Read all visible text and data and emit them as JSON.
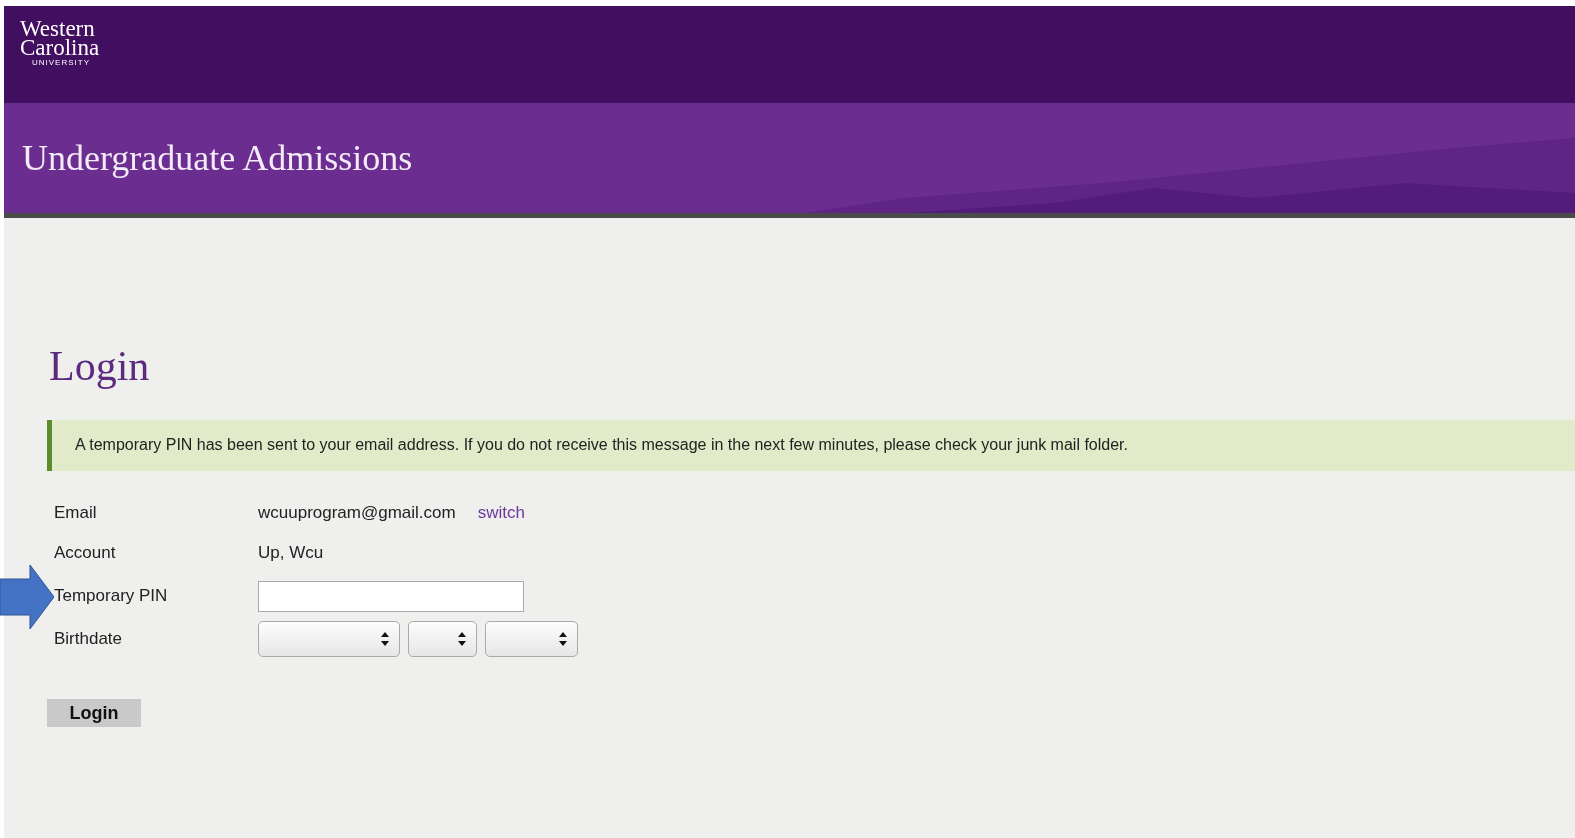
{
  "logo": {
    "lines": [
      "Western",
      "Carolina",
      "UNIVERSITY"
    ]
  },
  "banner": {
    "title": "Undergraduate Admissions"
  },
  "heading": "Login",
  "notice": "A temporary PIN has been sent to your email address. If you do not receive this message in the next few minutes, please check your junk mail folder.",
  "form": {
    "email": {
      "label": "Email",
      "value": "wcuuprogram@gmail.com",
      "link": "switch"
    },
    "account": {
      "label": "Account",
      "value": "Up, Wcu"
    },
    "pin": {
      "label": "Temporary PIN"
    },
    "birthdate": {
      "label": "Birthdate",
      "selects": [
        {
          "kind": "dropdown"
        },
        {
          "kind": "dropdown"
        },
        {
          "kind": "dropdown"
        }
      ]
    }
  },
  "button": "Login"
}
